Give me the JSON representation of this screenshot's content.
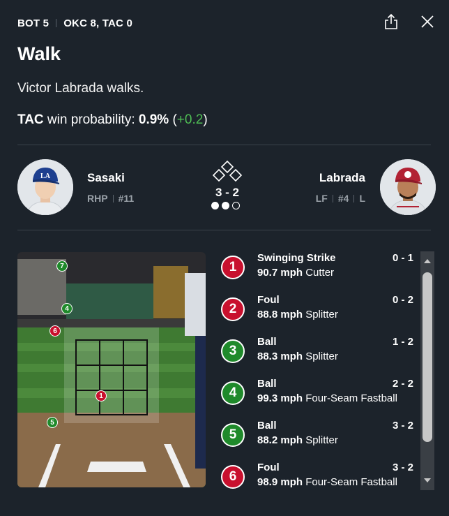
{
  "header": {
    "inning": "BOT 5",
    "score": "OKC 8, TAC 0"
  },
  "play": {
    "title": "Walk",
    "description": "Victor Labrada walks.",
    "win_prob": {
      "team": "TAC",
      "label": "win probability:",
      "value": "0.9%",
      "open_paren": "(",
      "delta": "+0.2",
      "close_paren": ")"
    }
  },
  "pitcher": {
    "name": "Sasaki",
    "throws": "RHP",
    "number": "#11"
  },
  "batter": {
    "name": "Labrada",
    "position": "LF",
    "number": "#4",
    "bats": "L"
  },
  "count": {
    "value": "3 - 2",
    "outs_filled": 2,
    "outs_total": 3
  },
  "field": {
    "markers": [
      {
        "label": "7",
        "result": "ball"
      },
      {
        "label": "4",
        "result": "ball"
      },
      {
        "label": "6",
        "result": "strike"
      },
      {
        "label": "1",
        "result": "strike"
      },
      {
        "label": "5",
        "result": "ball"
      }
    ]
  },
  "pitches": [
    {
      "num": "1",
      "result": "Swinging Strike",
      "count": "0 - 1",
      "speed": "90.7 mph",
      "type": "Cutter",
      "color": "#c8102e"
    },
    {
      "num": "2",
      "result": "Foul",
      "count": "0 - 2",
      "speed": "88.8 mph",
      "type": "Splitter",
      "color": "#c8102e"
    },
    {
      "num": "3",
      "result": "Ball",
      "count": "1 - 2",
      "speed": "88.3 mph",
      "type": "Splitter",
      "color": "#1f8a2b"
    },
    {
      "num": "4",
      "result": "Ball",
      "count": "2 - 2",
      "speed": "99.3 mph",
      "type": "Four-Seam Fastball",
      "color": "#1f8a2b"
    },
    {
      "num": "5",
      "result": "Ball",
      "count": "3 - 2",
      "speed": "88.2 mph",
      "type": "Splitter",
      "color": "#1f8a2b"
    },
    {
      "num": "6",
      "result": "Foul",
      "count": "3 - 2",
      "speed": "98.9 mph",
      "type": "Four-Seam Fastball",
      "color": "#c8102e"
    }
  ],
  "colors": {
    "strike": "#c8102e",
    "ball": "#1f8a2b",
    "delta_positive": "#4fbf55",
    "background": "#1c232b"
  }
}
